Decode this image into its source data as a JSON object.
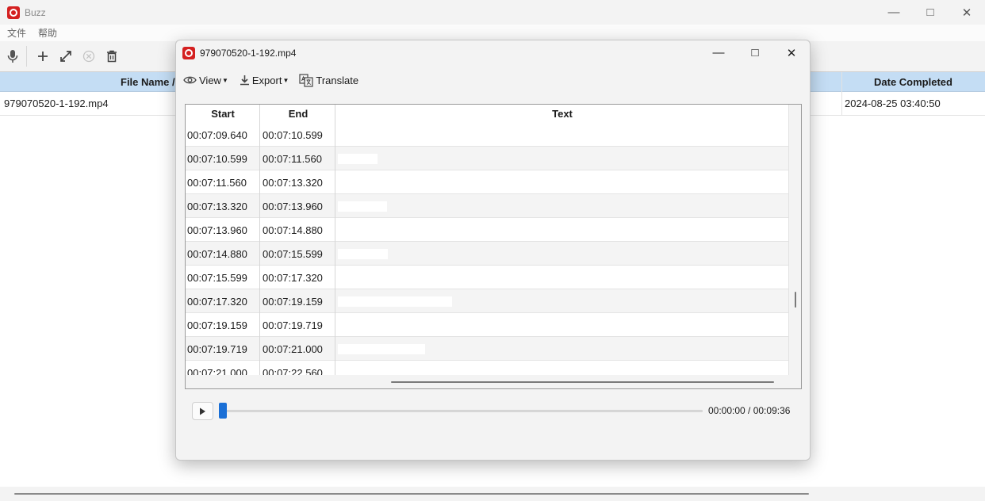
{
  "main_window": {
    "title": "Buzz",
    "menu": [
      "文件",
      "帮助"
    ],
    "table": {
      "columns": [
        "File Name / URL",
        "Date Completed"
      ],
      "rows": [
        {
          "file_name": "979070520-1-192.mp4",
          "date_completed": "2024-08-25 03:40:50"
        }
      ]
    }
  },
  "dialog": {
    "title": "979070520-1-192.mp4",
    "toolbar": {
      "view": "View",
      "export": "Export",
      "translate": "Translate"
    },
    "columns": {
      "start": "Start",
      "end": "End",
      "text": "Text"
    },
    "segments": [
      {
        "start": "00:07:09.640",
        "end": "00:07:10.599",
        "text": ""
      },
      {
        "start": "00:07:10.599",
        "end": "00:07:11.560",
        "text": ""
      },
      {
        "start": "00:07:11.560",
        "end": "00:07:13.320",
        "text": ""
      },
      {
        "start": "00:07:13.320",
        "end": "00:07:13.960",
        "text": ""
      },
      {
        "start": "00:07:13.960",
        "end": "00:07:14.880",
        "text": ""
      },
      {
        "start": "00:07:14.880",
        "end": "00:07:15.599",
        "text": ""
      },
      {
        "start": "00:07:15.599",
        "end": "00:07:17.320",
        "text": ""
      },
      {
        "start": "00:07:17.320",
        "end": "00:07:19.159",
        "text": ""
      },
      {
        "start": "00:07:19.159",
        "end": "00:07:19.719",
        "text": ""
      },
      {
        "start": "00:07:19.719",
        "end": "00:07:21.000",
        "text": ""
      },
      {
        "start": "00:07:21.000",
        "end": "00:07:22.560",
        "text": ""
      }
    ],
    "player": {
      "time": "00:00:00 / 00:09:36",
      "progress": 0
    }
  }
}
